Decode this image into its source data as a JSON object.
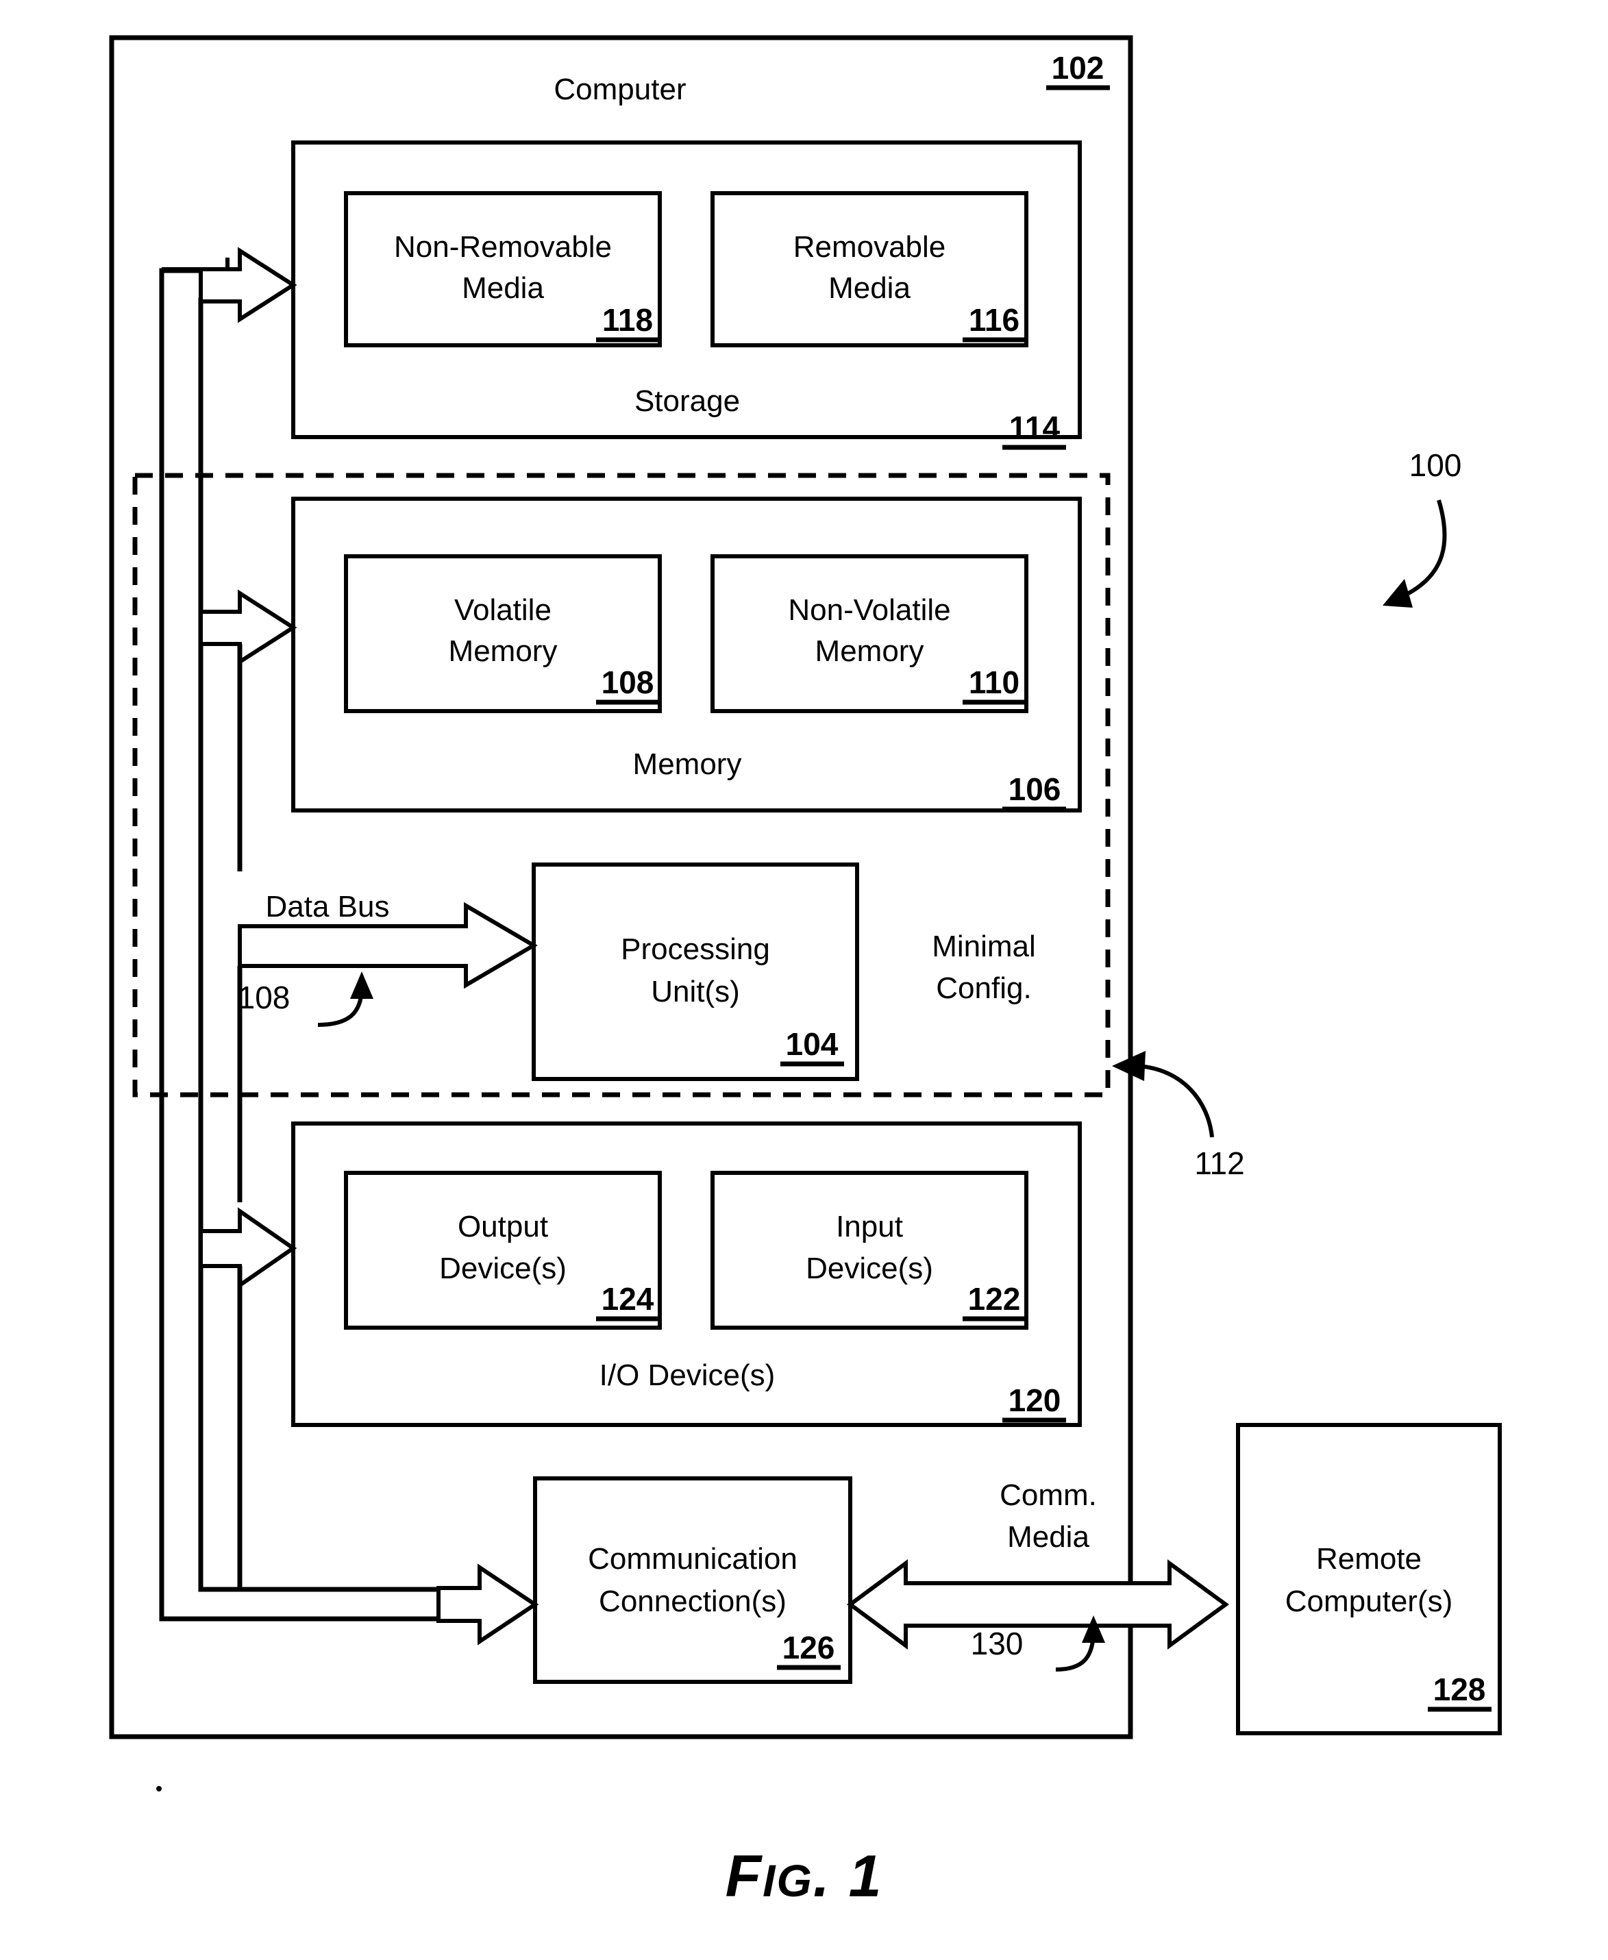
{
  "figure": {
    "caption_prefix": "F",
    "caption_small": "IG",
    "caption_suffix": ". 1",
    "caption_full": "FIG. 1",
    "system_ref": "100"
  },
  "computer": {
    "title": "Computer",
    "ref": "102"
  },
  "storage": {
    "title": "Storage",
    "ref": "114",
    "children": [
      {
        "title_line1": "Non-Removable",
        "title_line2": "Media",
        "ref": "118"
      },
      {
        "title_line1": "Removable",
        "title_line2": "Media",
        "ref": "116"
      }
    ]
  },
  "memory": {
    "title": "Memory",
    "ref": "106",
    "children": [
      {
        "title_line1": "Volatile",
        "title_line2": "Memory",
        "ref": "108"
      },
      {
        "title_line1": "Non-Volatile",
        "title_line2": "Memory",
        "ref": "110"
      }
    ]
  },
  "processing": {
    "title_line1": "Processing",
    "title_line2": "Unit(s)",
    "ref": "104"
  },
  "data_bus": {
    "label": "Data Bus",
    "ref": "108"
  },
  "minimal_config": {
    "label_line1": "Minimal",
    "label_line2": "Config.",
    "ref": "112"
  },
  "io_devices": {
    "title": "I/O Device(s)",
    "ref": "120",
    "children": [
      {
        "title_line1": "Output",
        "title_line2": "Device(s)",
        "ref": "124"
      },
      {
        "title_line1": "Input",
        "title_line2": "Device(s)",
        "ref": "122"
      }
    ]
  },
  "communication": {
    "title_line1": "Communication",
    "title_line2": "Connection(s)",
    "ref": "126"
  },
  "comm_media": {
    "label_line1": "Comm.",
    "label_line2": "Media",
    "ref": "130"
  },
  "remote": {
    "title_line1": "Remote",
    "title_line2": "Computer(s)",
    "ref": "128"
  },
  "colors": {
    "stroke": "#000000",
    "fill": "#ffffff"
  }
}
